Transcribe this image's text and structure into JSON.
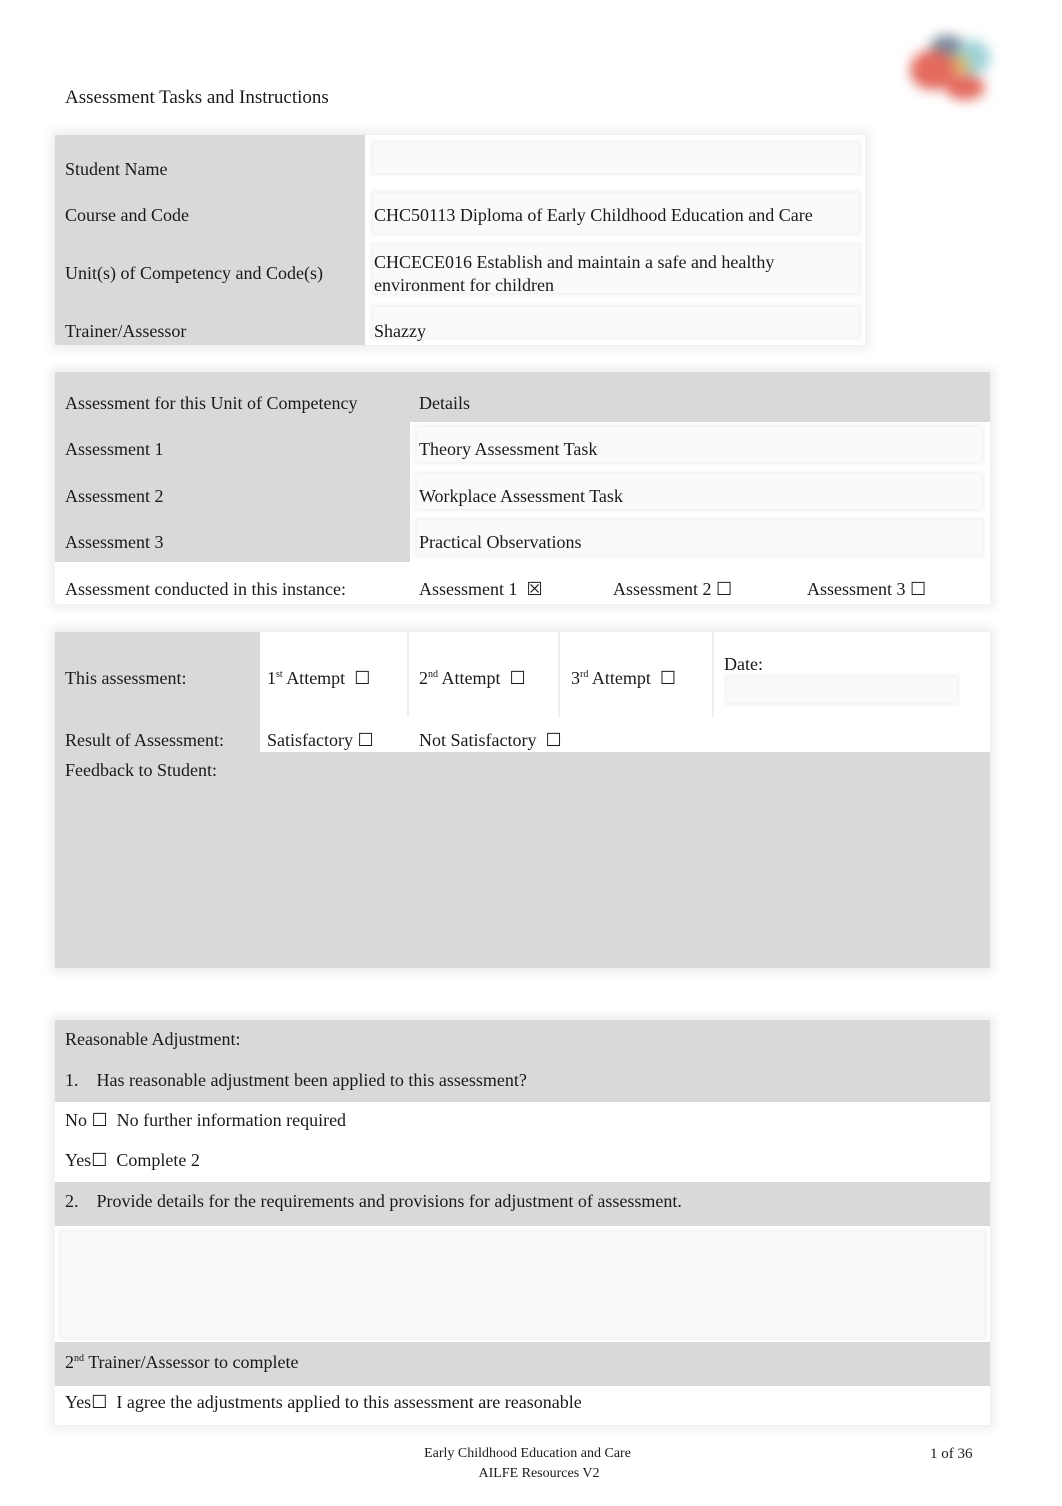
{
  "header": {
    "title": "Assessment Tasks and Instructions",
    "logo": "organisation-logo"
  },
  "student_info": {
    "rows": [
      {
        "label": "Student Name",
        "value": ""
      },
      {
        "label": "Course and Code",
        "value": "CHC50113 Diploma of Early Childhood Education and Care"
      },
      {
        "label": "Unit(s) of Competency and Code(s)",
        "value_line1": "CHCECE016 Establish and maintain a safe and healthy",
        "value_line2": "environment for children"
      },
      {
        "label": "Trainer/Assessor",
        "value": "Shazzy"
      }
    ]
  },
  "assessment_table": {
    "header_left": "Assessment for this Unit of Competency",
    "header_right": "Details",
    "rows": [
      {
        "label": "Assessment 1",
        "detail": "Theory Assessment Task"
      },
      {
        "label": "Assessment 2",
        "detail": "Workplace Assessment Task"
      },
      {
        "label": "Assessment 3",
        "detail": "Practical Observations"
      }
    ],
    "conducted_label": "Assessment conducted in this instance:",
    "conducted_options": [
      {
        "label": "Assessment 1",
        "checked": true,
        "box": "☒"
      },
      {
        "label": "Assessment 2",
        "checked": false,
        "box": "☐"
      },
      {
        "label": "Assessment 3",
        "checked": false,
        "box": "☐"
      }
    ]
  },
  "result_table": {
    "this_assessment_label": "This assessment:",
    "attempts": [
      {
        "num": "1",
        "sup": "st",
        "label": "Attempt",
        "box": "☐"
      },
      {
        "num": "2",
        "sup": "nd",
        "label": "Attempt",
        "box": "☐"
      },
      {
        "num": "3",
        "sup": "rd",
        "label": "Attempt",
        "box": "☐"
      }
    ],
    "date_label": "Date:",
    "date_value": "",
    "result_label": "Result of Assessment:",
    "satisfactory": {
      "label": "Satisfactory",
      "box": "☐"
    },
    "not_satisfactory": {
      "label": "Not Satisfactory",
      "box": "☐"
    },
    "feedback_label": "Feedback to Student:",
    "feedback_value": ""
  },
  "reasonable_adjustment": {
    "heading": "Reasonable Adjustment:",
    "q1_num": "1.",
    "q1": "Has reasonable adjustment been applied to this assessment?",
    "no_label": "No",
    "no_box": "☐",
    "no_text": "No further information required",
    "yes_label": "Yes",
    "yes_box": "☐",
    "yes_text": "Complete 2",
    "q2_num": "2.",
    "q2": "Provide details for the requirements and provisions for adjustment of assessment.",
    "details_value": "",
    "second_assessor_num": "2",
    "second_assessor_sup": "nd",
    "second_assessor_text": "Trainer/Assessor to complete",
    "agree_label": "Yes",
    "agree_box": "☐",
    "agree_text": "I agree the adjustments applied to this assessment are reasonable"
  },
  "footer": {
    "line1": "Early Childhood Education and Care",
    "line2": "AILFE Resources V2",
    "page": "1 of 36"
  }
}
